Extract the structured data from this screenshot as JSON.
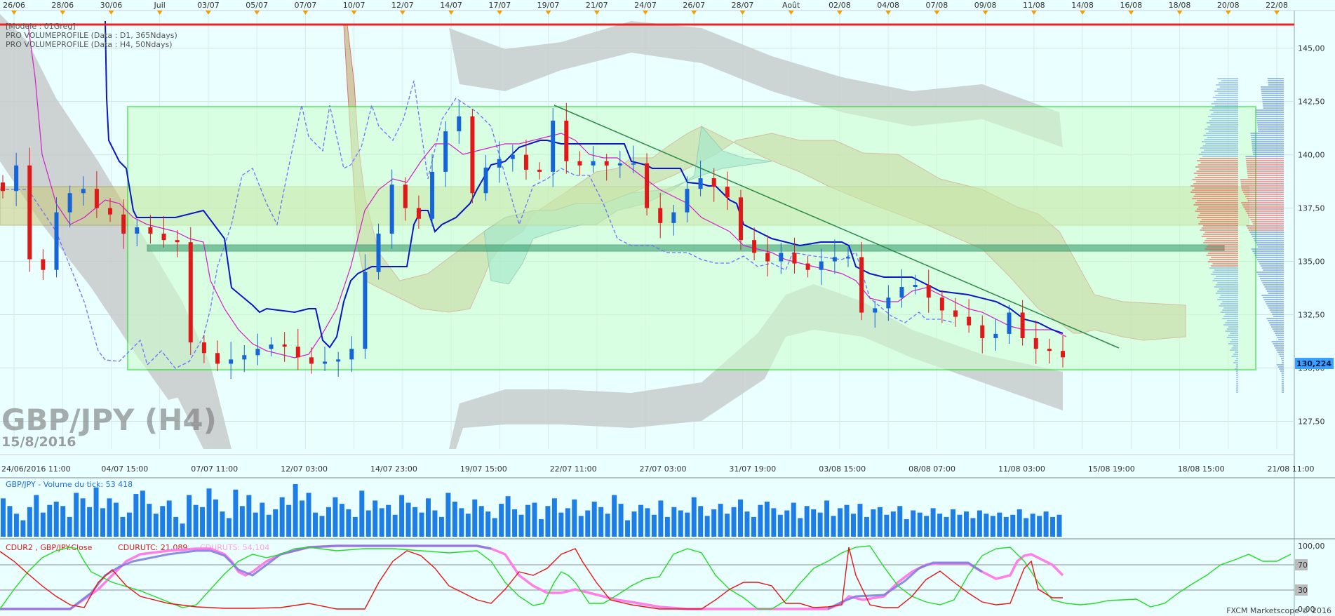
{
  "chart_data": {
    "type": "candlestick",
    "symbol": "GBP/JPY (H4)",
    "date_watermark": "15/8/2016",
    "legend_lines": [
      "[Modele : 01Greg]",
      "PRO VOLUMEPROFILE (Data : D1, 365Ndays)",
      "PRO VOLUMEPROFILE (Data : H4, 50Ndays)"
    ],
    "top_dates": [
      "26/06",
      "28/06",
      "30/06",
      "Juil",
      "03/07",
      "05/07",
      "07/07",
      "10/07",
      "12/07",
      "14/07",
      "17/07",
      "19/07",
      "21/07",
      "24/07",
      "26/07",
      "28/07",
      "Août",
      "02/08",
      "04/08",
      "07/08",
      "09/08",
      "11/08",
      "14/08",
      "16/08",
      "18/08",
      "20/08",
      "22/08"
    ],
    "bottom_dates": [
      "24/06/2016 11:00",
      "04/07 15:00",
      "07/07 11:00",
      "12/07 03:00",
      "14/07 23:00",
      "19/07 15:00",
      "22/07 11:00",
      "27/07 03:00",
      "31/07 19:00",
      "03/08 15:00",
      "08/08 07:00",
      "11/08 03:00",
      "15/08 19:00",
      "18/08 15:00",
      "21/08 11:00"
    ],
    "y_ticks": [
      "145,00",
      "142,50",
      "140,00",
      "137,50",
      "135,00",
      "132,50",
      "130,00",
      "127,50"
    ],
    "ylim": [
      126.2,
      146.6
    ],
    "last_price": "130,224",
    "price_series": [
      {
        "name": "close_approx",
        "values": [
          138.3,
          139.5,
          135.1,
          134.6,
          137.3,
          138.2,
          138.4,
          137.5,
          137.2,
          136.3,
          136.6,
          136.3,
          136.0,
          135.9,
          131.2,
          130.7,
          130.2,
          130.4,
          130.6,
          130.9,
          131.1,
          131.0,
          130.5,
          130.2,
          130.3,
          130.4,
          130.9,
          134.5,
          136.3,
          138.6,
          137.5,
          137.0,
          139.2,
          141.1,
          141.8,
          138.2,
          139.4,
          139.8,
          140.0,
          139.3,
          139.2,
          141.6,
          139.7,
          139.5,
          139.7,
          139.5,
          139.6,
          139.6,
          137.5,
          136.8,
          137.3,
          138.4,
          138.9,
          138.5,
          138.0,
          136.0,
          135.4,
          135.0,
          135.4,
          134.9,
          134.6,
          135.0,
          135.2,
          135.2,
          132.6,
          132.8,
          133.3,
          133.8,
          133.9,
          133.3,
          132.7,
          132.4,
          132.0,
          131.4,
          131.6,
          132.6,
          131.4,
          130.9,
          130.8,
          130.5
        ]
      }
    ],
    "volume_panel": {
      "title": "GBP/JPY - Volume du tick: 53 418",
      "values": [
        35,
        28,
        21,
        15,
        27,
        38,
        22,
        29,
        32,
        28,
        18,
        40,
        35,
        27,
        45,
        26,
        35,
        31,
        18,
        22,
        39,
        42,
        30,
        21,
        28,
        33,
        18,
        12,
        38,
        29,
        27,
        44,
        34,
        23,
        17,
        43,
        28,
        38,
        22,
        31,
        20,
        25,
        36,
        29,
        48,
        33,
        40,
        22,
        19,
        27,
        36,
        30,
        25,
        18,
        42,
        24,
        33,
        26,
        29,
        20,
        38,
        31,
        27,
        22,
        35,
        24,
        18,
        40,
        32,
        26,
        21,
        34,
        28,
        23,
        17,
        30,
        37,
        25,
        20,
        29,
        31,
        16,
        28,
        35,
        22,
        26,
        34,
        19,
        24,
        32,
        27,
        21,
        38,
        30,
        15,
        23,
        29,
        26,
        20,
        33,
        18,
        27,
        24,
        22,
        36,
        28,
        19,
        25,
        30,
        21,
        27,
        34,
        23,
        18,
        29,
        32,
        26,
        20,
        24,
        31,
        17,
        28,
        25,
        22,
        33,
        19,
        26,
        29,
        21,
        30,
        18,
        25,
        27,
        20,
        23,
        28,
        16,
        24,
        22,
        19,
        26,
        21,
        18,
        25,
        20,
        23,
        17,
        24,
        21,
        19,
        22,
        18,
        20,
        25,
        17,
        21,
        19,
        23,
        18,
        20
      ]
    },
    "oscillator_panel": {
      "label_cdur2": "CDUR2 , GBP/JPY.Close",
      "label_cdurutc": "CDURUTC: 21,089",
      "label_cdurutS": "CDURUTS: 54,104",
      "y_ticks": [
        "100,00",
        "70",
        "30",
        "0,00"
      ],
      "ylim": [
        0,
        100
      ]
    },
    "credit": "FXCM Marketscope © 2016"
  },
  "colors": {
    "background": "#eaffff",
    "bull": "#1565d8",
    "bear": "#e01818",
    "kijun": "#0a16c8",
    "tenkan": "#d21ec8",
    "chikou": "#7070ff",
    "box": "#22dd22",
    "trend": "#2a8a4a",
    "volume": "#1d7ee8",
    "osc_green": "#22dd22",
    "osc_red": "#ee1111",
    "osc_pink": "#ff7fe8"
  }
}
